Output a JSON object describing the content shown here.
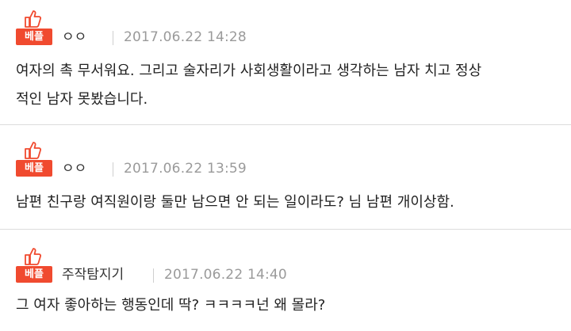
{
  "comments": [
    {
      "badge": "베플",
      "nickname": "ㅇㅇ",
      "date": "2017.06.22 14:28",
      "lines": [
        "여자의 촉 무서워요. 그리고 술자리가 사회생활이라고 생각하는 남자 치고 정상",
        "적인 남자 못봤습니다."
      ]
    },
    {
      "badge": "베플",
      "nickname": "ㅇㅇ",
      "date": "2017.06.22 13:59",
      "lines": [
        "남편 친구랑 여직원이랑 둘만 남으면 안 되는 일이라도? 님 남편 개이상함."
      ]
    },
    {
      "badge": "베플",
      "nickname": "주작탐지기",
      "date": "2017.06.22 14:40",
      "lines": [
        "그 여자 좋아하는 행동인데 딱? ㅋㅋㅋㅋ넌 왜 몰라?"
      ]
    }
  ],
  "icons": {
    "badge_icon": "thumbs-up-icon"
  },
  "colors": {
    "badge": "#f04a2f",
    "date": "#9a9a9a",
    "divider": "#dcdcdc"
  }
}
